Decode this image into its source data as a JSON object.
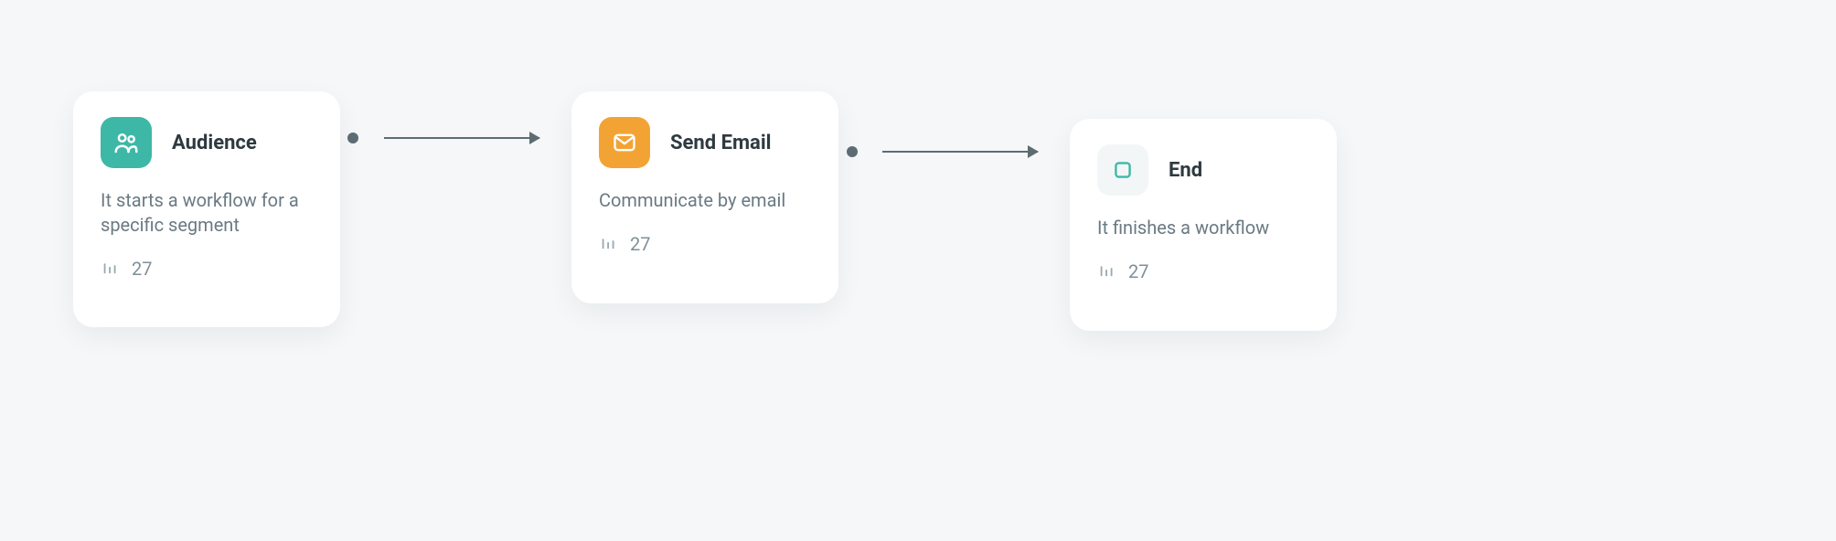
{
  "nodes": [
    {
      "id": "audience",
      "icon": "users-icon",
      "iconStyle": "teal",
      "title": "Audience",
      "description": "It starts a workflow for a specific segment",
      "metric": "27"
    },
    {
      "id": "send-email",
      "icon": "mail-icon",
      "iconStyle": "amber",
      "title": "Send Email",
      "description": "Communicate by email",
      "metric": "27"
    },
    {
      "id": "end",
      "icon": "square-icon",
      "iconStyle": "light",
      "title": "End",
      "description": "It finishes a workflow",
      "metric": "27"
    }
  ]
}
